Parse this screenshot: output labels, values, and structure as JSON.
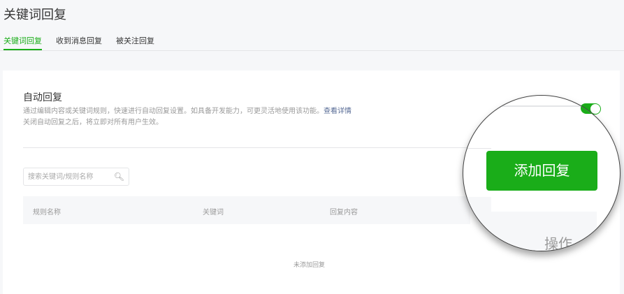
{
  "page_title": "关键词回复",
  "tabs": [
    {
      "label": "关键词回复"
    },
    {
      "label": "收到消息回复"
    },
    {
      "label": "被关注回复"
    }
  ],
  "auto_reply": {
    "title": "自动回复",
    "desc_line1": "通过编辑内容或关键词规则，快速进行自动回复设置。如具备开发能力，可更灵活地使用该功能。",
    "detail_link": "查看详情",
    "desc_line2": "关闭自动回复之后，将立即对所有用户生效。",
    "enabled": true
  },
  "search": {
    "placeholder": "搜索关键词/规则名称",
    "value": ""
  },
  "table": {
    "headers": [
      "规则名称",
      "关键词",
      "回复内容",
      "操作"
    ],
    "empty_text": "未添加回复"
  },
  "add_button": "添加回复",
  "colors": {
    "accent": "#1aad19",
    "link": "#576b95"
  }
}
